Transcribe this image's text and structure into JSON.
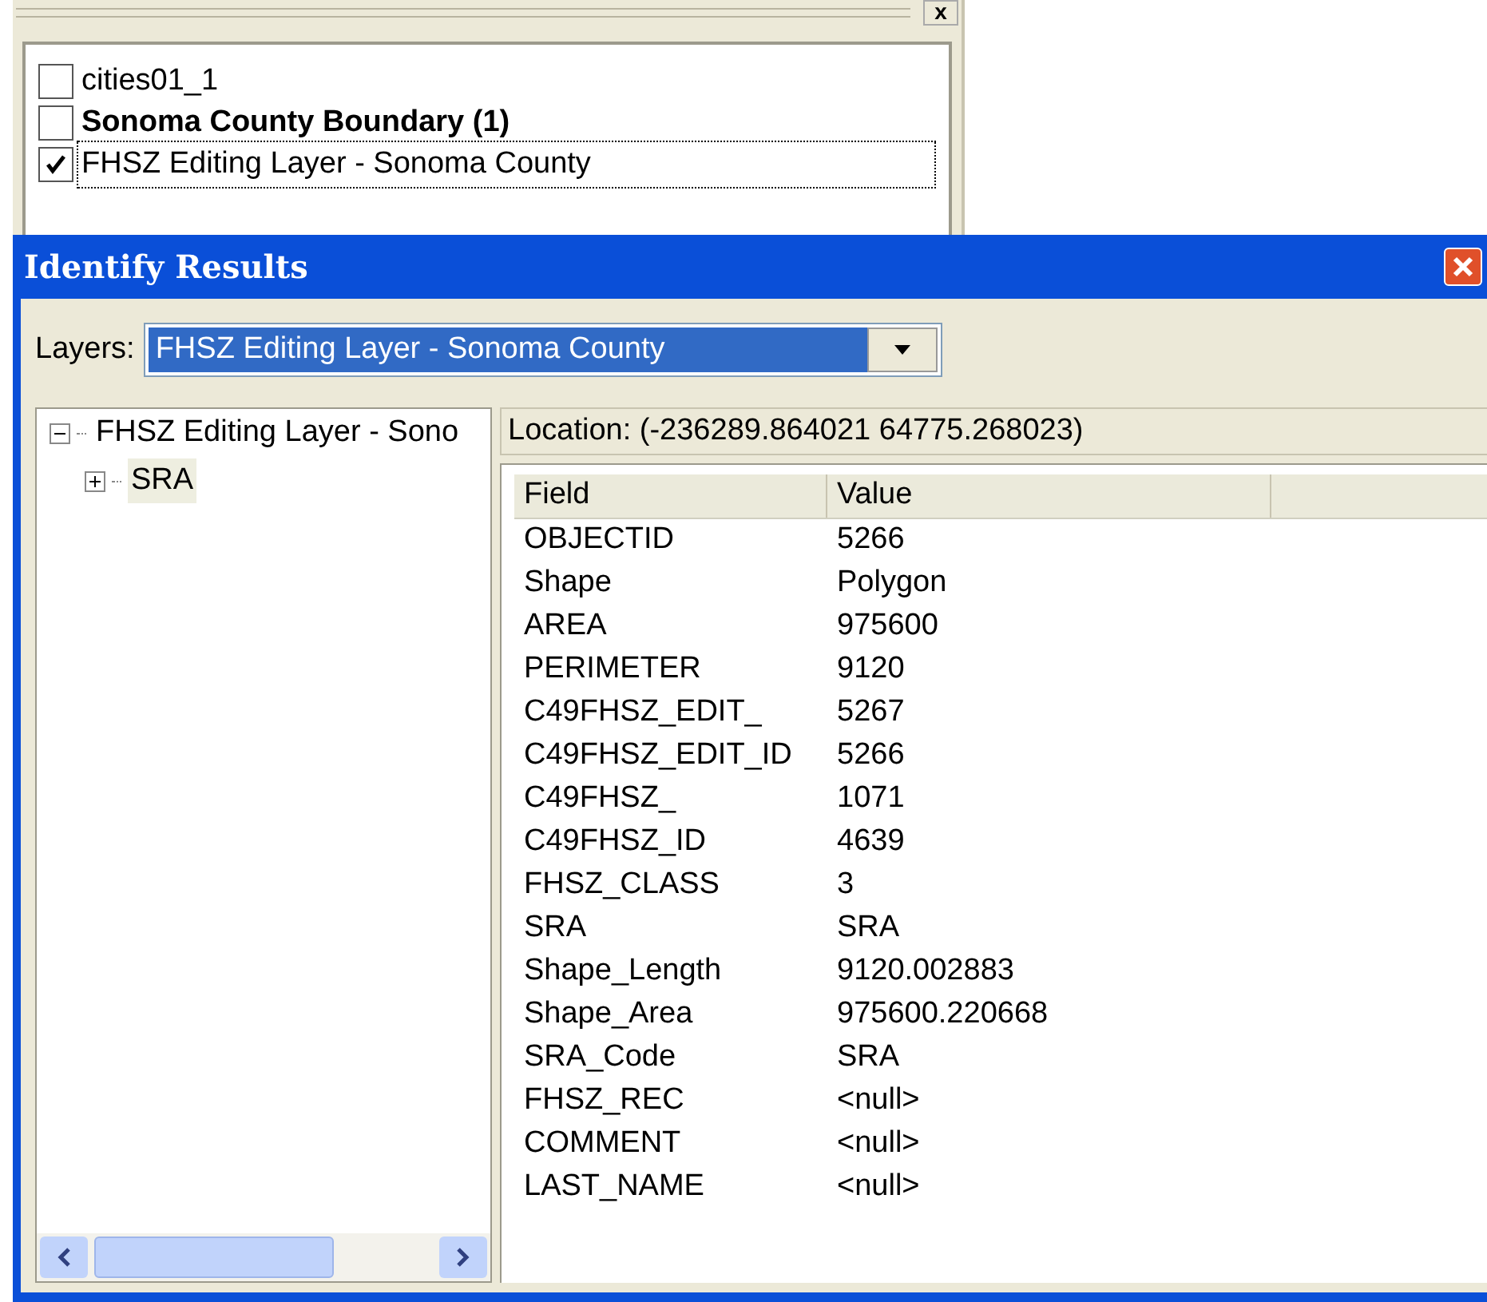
{
  "layer_list": {
    "close": "x",
    "items": [
      {
        "label": "cities01_1",
        "checked": false,
        "bold": false,
        "focused": false
      },
      {
        "label": "Sonoma County Boundary (1)",
        "checked": false,
        "bold": true,
        "focused": false
      },
      {
        "label": "FHSZ Editing Layer - Sonoma County",
        "checked": true,
        "bold": false,
        "focused": true
      }
    ]
  },
  "window": {
    "title": "Identify Results"
  },
  "layers": {
    "label": "Layers:",
    "value": "FHSZ Editing Layer - Sonoma County"
  },
  "tree": {
    "items": [
      {
        "label": "FHSZ Editing Layer - Sono",
        "expanded": true,
        "selected": false,
        "children": [
          {
            "label": "SRA",
            "expanded": false,
            "selected": true
          }
        ]
      }
    ]
  },
  "location": "Location: (-236289.864021 64775.268023)",
  "table": {
    "columns": [
      "Field",
      "Value"
    ],
    "rows": [
      [
        "OBJECTID",
        "5266"
      ],
      [
        "Shape",
        "Polygon"
      ],
      [
        "AREA",
        "975600"
      ],
      [
        "PERIMETER",
        "9120"
      ],
      [
        "C49FHSZ_EDIT_",
        "5267"
      ],
      [
        "C49FHSZ_EDIT_ID",
        "5266"
      ],
      [
        "C49FHSZ_",
        "1071"
      ],
      [
        "C49FHSZ_ID",
        "4639"
      ],
      [
        "FHSZ_CLASS",
        "3"
      ],
      [
        "SRA",
        "SRA"
      ],
      [
        "Shape_Length",
        "9120.002883"
      ],
      [
        "Shape_Area",
        "975600.220668"
      ],
      [
        "SRA_Code",
        "SRA"
      ],
      [
        "FHSZ_REC",
        "<null>"
      ],
      [
        "COMMENT",
        "<null>"
      ],
      [
        "LAST_NAME",
        "<null>"
      ]
    ]
  }
}
